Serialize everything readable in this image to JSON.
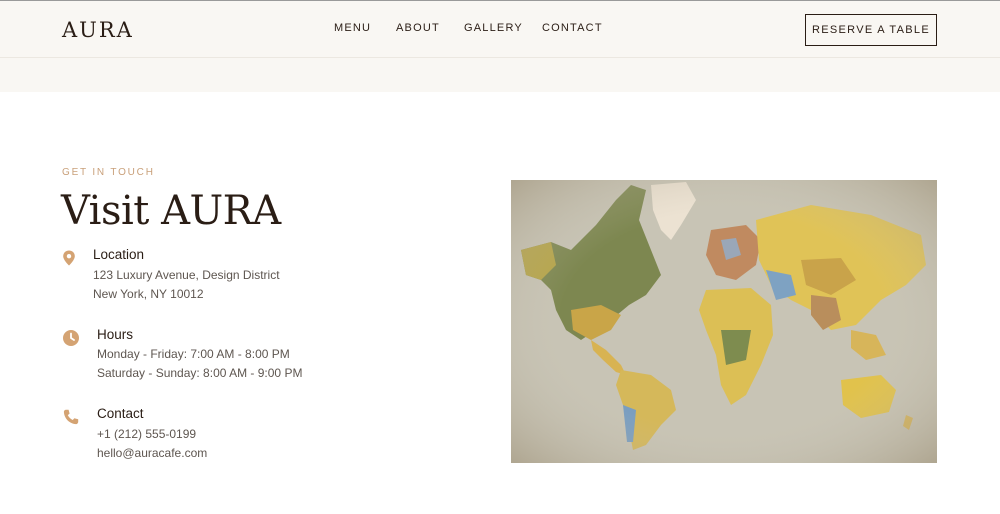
{
  "header": {
    "logo": "AURA",
    "nav": [
      {
        "label": "MENU"
      },
      {
        "label": "ABOUT"
      },
      {
        "label": "GALLERY"
      },
      {
        "label": "CONTACT"
      }
    ],
    "reserve_label": "RESERVE A TABLE"
  },
  "visit": {
    "eyebrow": "GET IN TOUCH",
    "title": "Visit AURA",
    "location": {
      "heading": "Location",
      "lines": [
        "123 Luxury Avenue, Design District",
        "New York, NY 10012"
      ]
    },
    "hours": {
      "heading": "Hours",
      "lines": [
        "Monday - Friday: 7:00 AM - 8:00 PM",
        "Saturday - Sunday: 8:00 AM - 9:00 PM"
      ]
    },
    "contact": {
      "heading": "Contact",
      "lines": [
        "+1 (212) 555-0199",
        "hello@auracafe.com"
      ]
    }
  },
  "colors": {
    "accent": "#c9a07a",
    "icon": "#d4a373",
    "text_dark": "#2a1d15",
    "header_bg": "#f9f7f3"
  },
  "icons": {
    "location": "map-pin-icon",
    "hours": "clock-icon",
    "contact": "phone-icon"
  }
}
